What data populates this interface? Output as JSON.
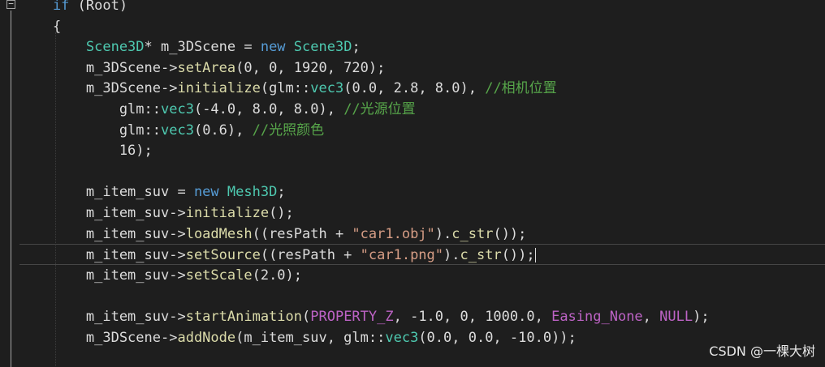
{
  "editor": {
    "lines": [
      [
        {
          "t": "kw",
          "v": "    if"
        },
        {
          "t": "plain",
          "v": " (Root)"
        }
      ],
      [
        {
          "t": "plain",
          "v": "    {"
        }
      ],
      [
        {
          "t": "type",
          "v": "        Scene3D"
        },
        {
          "t": "plain",
          "v": "* m_3DScene = "
        },
        {
          "t": "kw",
          "v": "new"
        },
        {
          "t": "plain",
          "v": " "
        },
        {
          "t": "type",
          "v": "Scene3D"
        },
        {
          "t": "plain",
          "v": ";"
        }
      ],
      [
        {
          "t": "plain",
          "v": "        m_3DScene->"
        },
        {
          "t": "fn",
          "v": "setArea"
        },
        {
          "t": "plain",
          "v": "(0, 0, 1920, 720);"
        }
      ],
      [
        {
          "t": "plain",
          "v": "        m_3DScene->"
        },
        {
          "t": "fn",
          "v": "initialize"
        },
        {
          "t": "plain",
          "v": "(glm::"
        },
        {
          "t": "type",
          "v": "vec3"
        },
        {
          "t": "plain",
          "v": "(0.0, 2.8, 8.0), "
        },
        {
          "t": "cmt",
          "v": "//相机位置"
        }
      ],
      [
        {
          "t": "plain",
          "v": "            glm::"
        },
        {
          "t": "type",
          "v": "vec3"
        },
        {
          "t": "plain",
          "v": "(-4.0, 8.0, 8.0), "
        },
        {
          "t": "cmt",
          "v": "//光源位置"
        }
      ],
      [
        {
          "t": "plain",
          "v": "            glm::"
        },
        {
          "t": "type",
          "v": "vec3"
        },
        {
          "t": "plain",
          "v": "(0.6), "
        },
        {
          "t": "cmt",
          "v": "//光照颜色"
        }
      ],
      [
        {
          "t": "plain",
          "v": "            16);"
        }
      ],
      [
        {
          "t": "plain",
          "v": ""
        }
      ],
      [
        {
          "t": "plain",
          "v": "        m_item_suv = "
        },
        {
          "t": "kw",
          "v": "new"
        },
        {
          "t": "plain",
          "v": " "
        },
        {
          "t": "type",
          "v": "Mesh3D"
        },
        {
          "t": "plain",
          "v": ";"
        }
      ],
      [
        {
          "t": "plain",
          "v": "        m_item_suv->"
        },
        {
          "t": "fn",
          "v": "initialize"
        },
        {
          "t": "plain",
          "v": "();"
        }
      ],
      [
        {
          "t": "plain",
          "v": "        m_item_suv->"
        },
        {
          "t": "fn",
          "v": "loadMesh"
        },
        {
          "t": "plain",
          "v": "((resPath + "
        },
        {
          "t": "str",
          "v": "\"car1.obj\""
        },
        {
          "t": "plain",
          "v": ")."
        },
        {
          "t": "fn",
          "v": "c_str"
        },
        {
          "t": "plain",
          "v": "());"
        }
      ],
      [
        {
          "t": "plain",
          "v": "        m_item_suv->"
        },
        {
          "t": "fn",
          "v": "setSource"
        },
        {
          "t": "plain",
          "v": "((resPath + "
        },
        {
          "t": "str",
          "v": "\"car1.png\""
        },
        {
          "t": "plain",
          "v": ")."
        },
        {
          "t": "fn",
          "v": "c_str"
        },
        {
          "t": "plain",
          "v": "());"
        }
      ],
      [
        {
          "t": "plain",
          "v": "        m_item_suv->"
        },
        {
          "t": "fn",
          "v": "setScale"
        },
        {
          "t": "plain",
          "v": "(2.0);"
        }
      ],
      [
        {
          "t": "plain",
          "v": ""
        }
      ],
      [
        {
          "t": "plain",
          "v": "        m_item_suv->"
        },
        {
          "t": "fn",
          "v": "startAnimation"
        },
        {
          "t": "plain",
          "v": "("
        },
        {
          "t": "macro",
          "v": "PROPERTY_Z"
        },
        {
          "t": "plain",
          "v": ", -1.0, 0, 1000.0, "
        },
        {
          "t": "macro",
          "v": "Easing_None"
        },
        {
          "t": "plain",
          "v": ", "
        },
        {
          "t": "macro",
          "v": "NULL"
        },
        {
          "t": "plain",
          "v": ");"
        }
      ],
      [
        {
          "t": "plain",
          "v": "        m_3DScene->"
        },
        {
          "t": "fn",
          "v": "addNode"
        },
        {
          "t": "plain",
          "v": "(m_item_suv, glm::"
        },
        {
          "t": "type",
          "v": "vec3"
        },
        {
          "t": "plain",
          "v": "(0.0, 0.0, -10.0));"
        }
      ]
    ],
    "current_line_index": 12
  },
  "watermark": "CSDN @一棵大树"
}
